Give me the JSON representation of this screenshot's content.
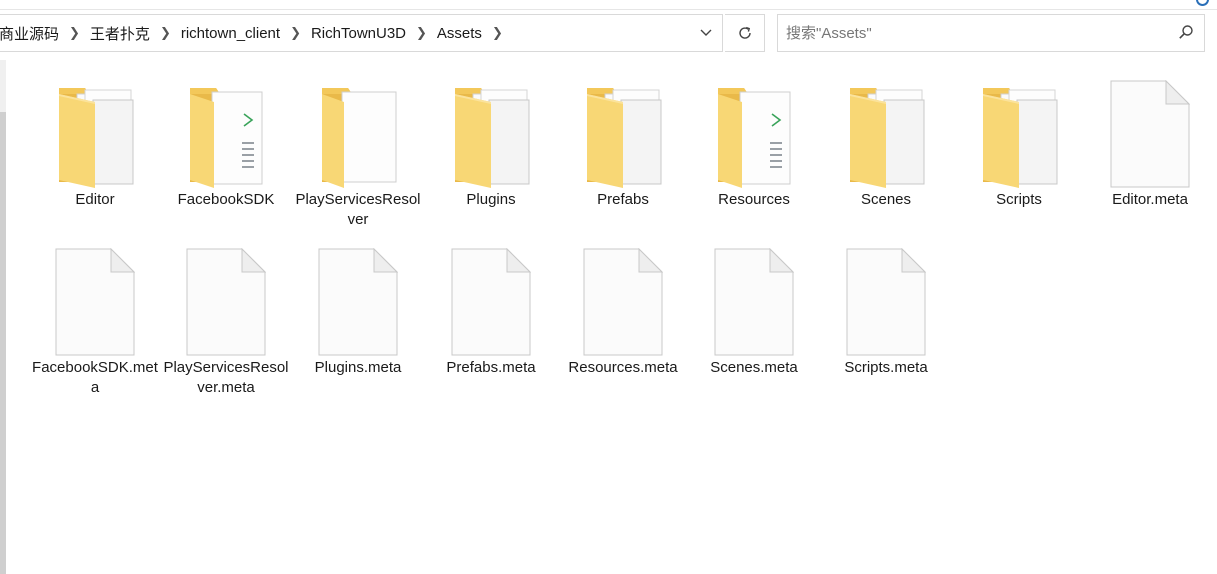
{
  "breadcrumb": {
    "items": [
      "商业源码",
      "王者扑克",
      "richtown_client",
      "RichTownU3D",
      "Assets"
    ]
  },
  "search": {
    "placeholder": "搜索\"Assets\""
  },
  "icons": {
    "breadcrumb_separator": "chevron-right-icon",
    "dropdown": "chevron-down-icon",
    "refresh": "refresh-icon",
    "search": "search-icon",
    "folder": "folder-icon",
    "file": "file-icon"
  },
  "colors": {
    "folder_front": "#f8d775",
    "folder_back": "#e9b949",
    "folder_tab": "#f3c85a",
    "page": "#fbfbfb",
    "page_border": "#c8c8c8"
  },
  "files": [
    {
      "name": "Editor",
      "type": "folder"
    },
    {
      "name": "FacebookSDK",
      "type": "folder-doc"
    },
    {
      "name": "PlayServicesResolver",
      "type": "folder-page"
    },
    {
      "name": "Plugins",
      "type": "folder"
    },
    {
      "name": "Prefabs",
      "type": "folder"
    },
    {
      "name": "Resources",
      "type": "folder-doc"
    },
    {
      "name": "Scenes",
      "type": "folder"
    },
    {
      "name": "Scripts",
      "type": "folder"
    },
    {
      "name": "Editor.meta",
      "type": "file"
    },
    {
      "name": "FacebookSDK.meta",
      "type": "file"
    },
    {
      "name": "PlayServicesResolver.meta",
      "type": "file"
    },
    {
      "name": "Plugins.meta",
      "type": "file"
    },
    {
      "name": "Prefabs.meta",
      "type": "file"
    },
    {
      "name": "Resources.meta",
      "type": "file"
    },
    {
      "name": "Scenes.meta",
      "type": "file"
    },
    {
      "name": "Scripts.meta",
      "type": "file"
    }
  ]
}
